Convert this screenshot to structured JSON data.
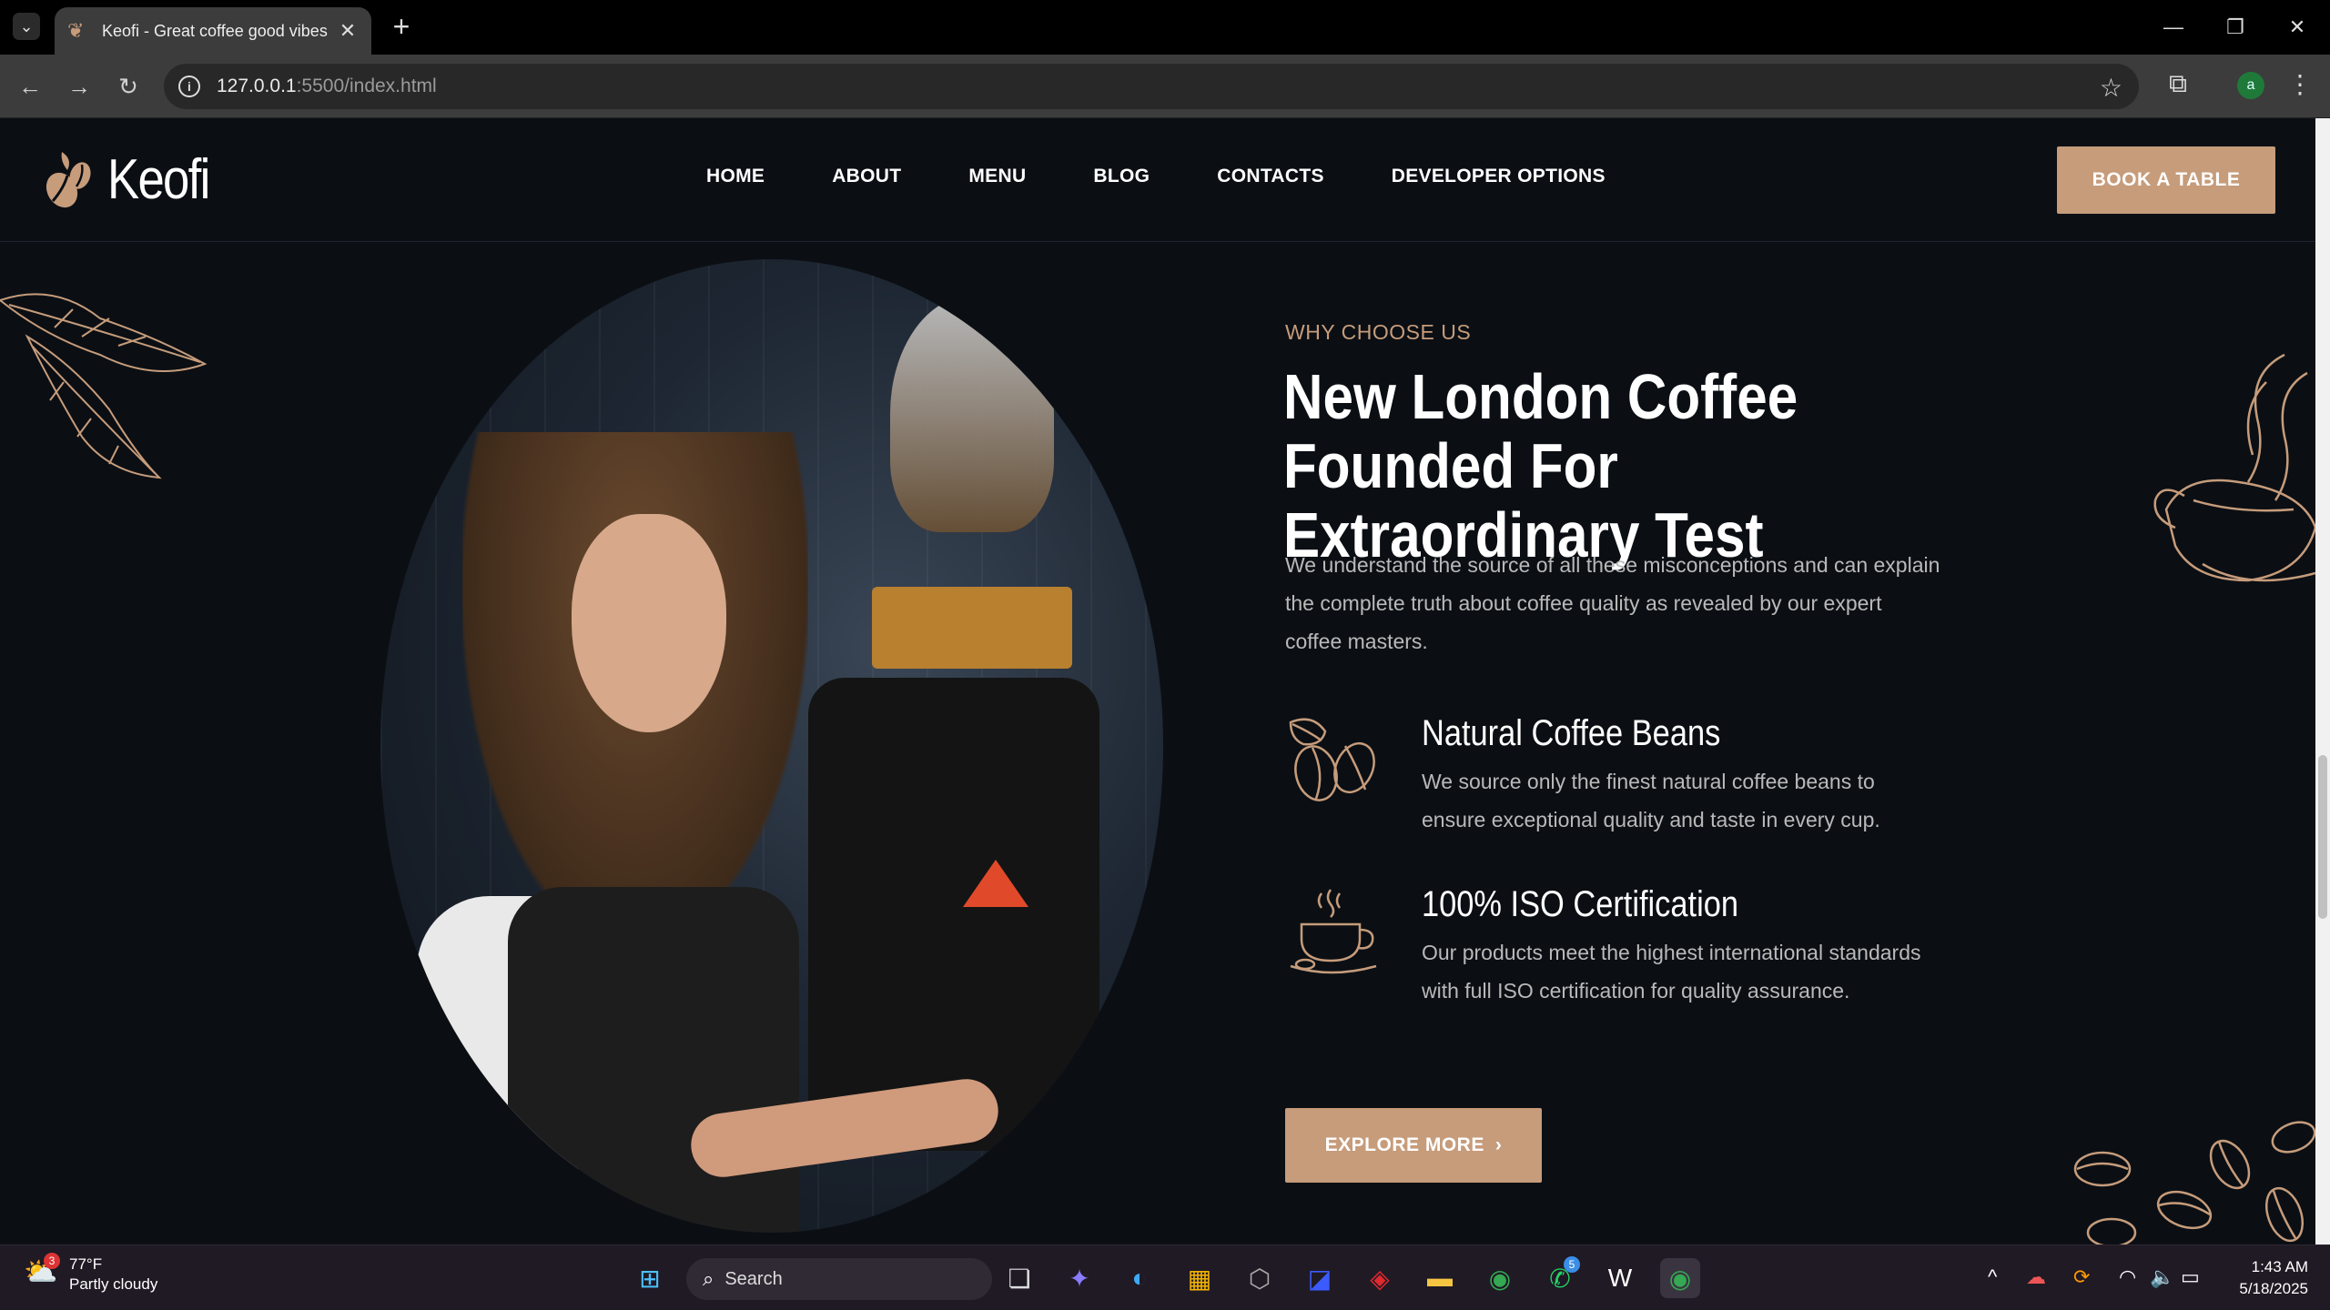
{
  "browser": {
    "tab_title": "Keofi - Great coffee good vibes",
    "url_host": "127.0.0.1",
    "url_path": ":5500/index.html",
    "profile_initial": "a"
  },
  "site": {
    "brand": "Keofi",
    "nav": [
      "HOME",
      "ABOUT",
      "MENU",
      "BLOG",
      "CONTACTS",
      "DEVELOPER OPTIONS"
    ],
    "book_button": "BOOK A TABLE",
    "kicker": "WHY CHOOSE US",
    "headline": "New London Coffee Founded For Extraordinary Test",
    "lead": "We understand the source of all these misconceptions and can explain the complete truth about coffee quality as revealed by our expert coffee masters.",
    "features": [
      {
        "title": "Natural Coffee Beans",
        "text": "We source only the finest natural coffee beans to ensure exceptional quality and taste in every cup.",
        "icon": "coffee-beans-icon"
      },
      {
        "title": "100% ISO Certification",
        "text": "Our products meet the highest international standards with full ISO certification for quality assurance.",
        "icon": "coffee-cup-icon"
      }
    ],
    "explore_button": "EXPLORE MORE",
    "colors": {
      "accent": "#c69c7b",
      "background": "#0b0f14",
      "body_text": "#b9b9b9"
    }
  },
  "taskbar": {
    "weather_temp": "77°F",
    "weather_desc": "Partly cloudy",
    "weather_badge": "3",
    "search_label": "Search",
    "whatsapp_badge": "5",
    "time": "1:43 AM",
    "date": "5/18/2025"
  }
}
